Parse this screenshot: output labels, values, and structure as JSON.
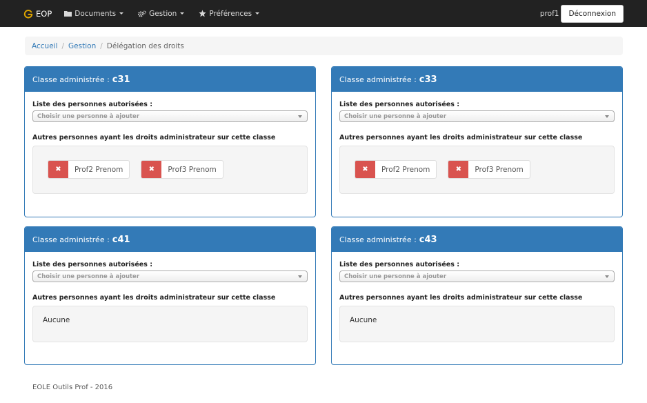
{
  "navbar": {
    "brand": "EOP",
    "menu": [
      {
        "label": "Documents",
        "icon": "folder-icon"
      },
      {
        "label": "Gestion",
        "icon": "gears-icon"
      },
      {
        "label": "Préférences",
        "icon": "star-icon"
      }
    ],
    "user": "prof1",
    "logout_label": "Déconnexion"
  },
  "breadcrumb": {
    "items": [
      "Accueil",
      "Gestion"
    ],
    "current": "Délégation des droits"
  },
  "panels": [
    {
      "heading_prefix": "Classe administrée :",
      "classe": "c31",
      "list_label": "Liste des personnes autorisées :",
      "select_placeholder": "Choisir une personne à ajouter",
      "others_label": "Autres personnes ayant les droits administrateur sur cette classe",
      "persons": [
        "Prof2 Prenom",
        "Prof3 Prenom"
      ]
    },
    {
      "heading_prefix": "Classe administrée :",
      "classe": "c33",
      "list_label": "Liste des personnes autorisées :",
      "select_placeholder": "Choisir une personne à ajouter",
      "others_label": "Autres personnes ayant les droits administrateur sur cette classe",
      "persons": [
        "Prof2 Prenom",
        "Prof3 Prenom"
      ]
    },
    {
      "heading_prefix": "Classe administrée :",
      "classe": "c41",
      "list_label": "Liste des personnes autorisées :",
      "select_placeholder": "Choisir une personne à ajouter",
      "others_label": "Autres personnes ayant les droits administrateur sur cette classe",
      "persons": [],
      "empty_text": "Aucune"
    },
    {
      "heading_prefix": "Classe administrée :",
      "classe": "c43",
      "list_label": "Liste des personnes autorisées :",
      "select_placeholder": "Choisir une personne à ajouter",
      "others_label": "Autres personnes ayant les droits administrateur sur cette classe",
      "persons": [],
      "empty_text": "Aucune"
    }
  ],
  "remove_symbol": "✖",
  "footer": "EOLE Outils Prof - 2016",
  "colors": {
    "navbar_bg": "#222222",
    "brand_accent": "#e0a600",
    "panel_primary": "#337ab7",
    "danger": "#d9534f",
    "link": "#337ab7"
  }
}
